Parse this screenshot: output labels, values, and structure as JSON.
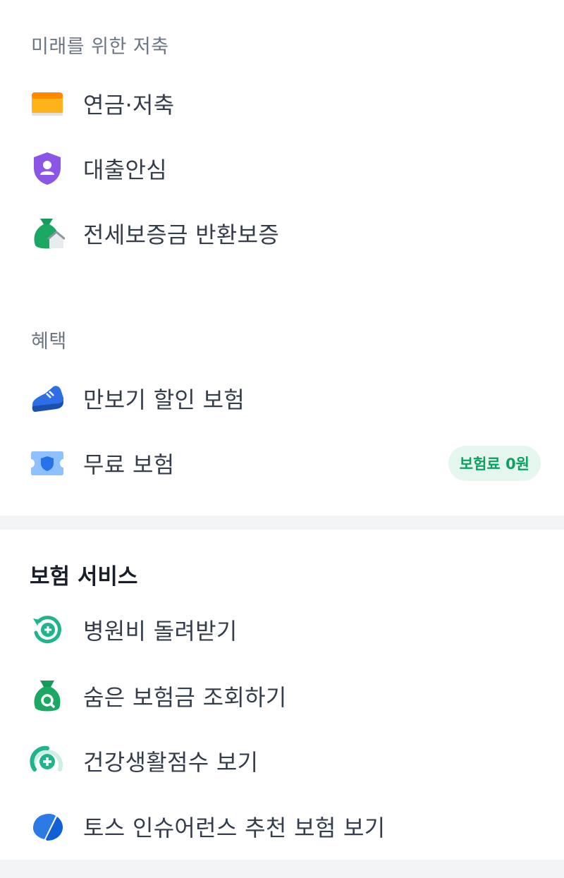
{
  "savings_section": {
    "label": "미래를 위한 저축",
    "items": [
      {
        "label": "연금·저축",
        "icon": "card-icon"
      },
      {
        "label": "대출안심",
        "icon": "shield-person-icon"
      },
      {
        "label": "전세보증금 반환보증",
        "icon": "money-bag-house-icon"
      }
    ]
  },
  "benefits_section": {
    "label": "혜택",
    "items": [
      {
        "label": "만보기 할인 보험",
        "icon": "sneaker-icon"
      },
      {
        "label": "무료 보험",
        "icon": "ticket-shield-icon",
        "badge": "보험료 0원"
      }
    ]
  },
  "insurance_services": {
    "title": "보험 서비스",
    "items": [
      {
        "label": "병원비 돌려받기",
        "icon": "refresh-plus-icon"
      },
      {
        "label": "숨은 보험금 조회하기",
        "icon": "money-bag-search-icon"
      },
      {
        "label": "건강생활점수 보기",
        "icon": "gauge-plus-icon"
      },
      {
        "label": "토스 인슈어런스 추천 보험 보기",
        "icon": "toss-insurance-logo-icon"
      }
    ]
  },
  "colors": {
    "accent_green": "#0e9f63",
    "badge_bg": "#e5f6ee",
    "divider": "#f2f4f6"
  }
}
